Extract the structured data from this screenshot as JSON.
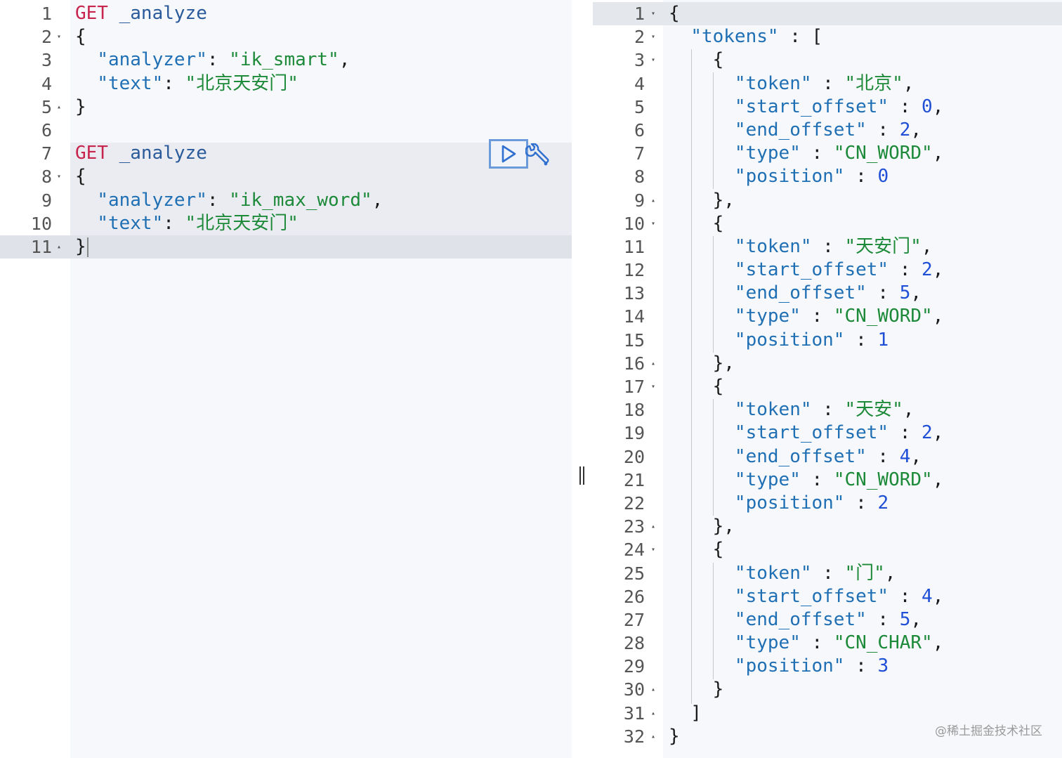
{
  "left_editor": {
    "lines": [
      {
        "n": "1",
        "fold": "",
        "parts": [
          [
            "method",
            "GET"
          ],
          [
            "punc",
            " "
          ],
          [
            "path",
            "_analyze"
          ]
        ]
      },
      {
        "n": "2",
        "fold": "▾",
        "parts": [
          [
            "punc",
            "{"
          ]
        ]
      },
      {
        "n": "3",
        "fold": "",
        "parts": [
          [
            "punc",
            "  "
          ],
          [
            "key",
            "\"analyzer\""
          ],
          [
            "punc",
            ": "
          ],
          [
            "str",
            "\"ik_smart\""
          ],
          [
            "punc",
            ","
          ]
        ]
      },
      {
        "n": "4",
        "fold": "",
        "parts": [
          [
            "punc",
            "  "
          ],
          [
            "key",
            "\"text\""
          ],
          [
            "punc",
            ": "
          ],
          [
            "str",
            "\"北京天安门\""
          ]
        ]
      },
      {
        "n": "5",
        "fold": "▴",
        "parts": [
          [
            "punc",
            "}"
          ]
        ]
      },
      {
        "n": "6",
        "fold": "",
        "parts": []
      },
      {
        "n": "7",
        "fold": "",
        "parts": [
          [
            "method",
            "GET"
          ],
          [
            "punc",
            " "
          ],
          [
            "path",
            "_analyze"
          ]
        ]
      },
      {
        "n": "8",
        "fold": "▾",
        "parts": [
          [
            "punc",
            "{"
          ]
        ]
      },
      {
        "n": "9",
        "fold": "",
        "parts": [
          [
            "punc",
            "  "
          ],
          [
            "key",
            "\"analyzer\""
          ],
          [
            "punc",
            ": "
          ],
          [
            "str",
            "\"ik_max_word\""
          ],
          [
            "punc",
            ","
          ]
        ]
      },
      {
        "n": "10",
        "fold": "",
        "parts": [
          [
            "punc",
            "  "
          ],
          [
            "key",
            "\"text\""
          ],
          [
            "punc",
            ": "
          ],
          [
            "str",
            "\"北京天安门\""
          ]
        ]
      },
      {
        "n": "11",
        "fold": "▴",
        "parts": [
          [
            "punc",
            "}"
          ]
        ]
      }
    ]
  },
  "right_editor": {
    "lines": [
      {
        "n": "1",
        "fold": "▾",
        "parts": [
          [
            "punc",
            "{"
          ]
        ]
      },
      {
        "n": "2",
        "fold": "▾",
        "parts": [
          [
            "punc",
            "  "
          ],
          [
            "key",
            "\"tokens\""
          ],
          [
            "punc",
            " : ["
          ]
        ]
      },
      {
        "n": "3",
        "fold": "▾",
        "parts": [
          [
            "punc",
            "    {"
          ]
        ]
      },
      {
        "n": "4",
        "fold": "",
        "parts": [
          [
            "punc",
            "      "
          ],
          [
            "key",
            "\"token\""
          ],
          [
            "punc",
            " : "
          ],
          [
            "str",
            "\"北京\""
          ],
          [
            "punc",
            ","
          ]
        ]
      },
      {
        "n": "5",
        "fold": "",
        "parts": [
          [
            "punc",
            "      "
          ],
          [
            "key",
            "\"start_offset\""
          ],
          [
            "punc",
            " : "
          ],
          [
            "num",
            "0"
          ],
          [
            "punc",
            ","
          ]
        ]
      },
      {
        "n": "6",
        "fold": "",
        "parts": [
          [
            "punc",
            "      "
          ],
          [
            "key",
            "\"end_offset\""
          ],
          [
            "punc",
            " : "
          ],
          [
            "num",
            "2"
          ],
          [
            "punc",
            ","
          ]
        ]
      },
      {
        "n": "7",
        "fold": "",
        "parts": [
          [
            "punc",
            "      "
          ],
          [
            "key",
            "\"type\""
          ],
          [
            "punc",
            " : "
          ],
          [
            "str",
            "\"CN_WORD\""
          ],
          [
            "punc",
            ","
          ]
        ]
      },
      {
        "n": "8",
        "fold": "",
        "parts": [
          [
            "punc",
            "      "
          ],
          [
            "key",
            "\"position\""
          ],
          [
            "punc",
            " : "
          ],
          [
            "num",
            "0"
          ]
        ]
      },
      {
        "n": "9",
        "fold": "▴",
        "parts": [
          [
            "punc",
            "    },"
          ]
        ]
      },
      {
        "n": "10",
        "fold": "▾",
        "parts": [
          [
            "punc",
            "    {"
          ]
        ]
      },
      {
        "n": "11",
        "fold": "",
        "parts": [
          [
            "punc",
            "      "
          ],
          [
            "key",
            "\"token\""
          ],
          [
            "punc",
            " : "
          ],
          [
            "str",
            "\"天安门\""
          ],
          [
            "punc",
            ","
          ]
        ]
      },
      {
        "n": "12",
        "fold": "",
        "parts": [
          [
            "punc",
            "      "
          ],
          [
            "key",
            "\"start_offset\""
          ],
          [
            "punc",
            " : "
          ],
          [
            "num",
            "2"
          ],
          [
            "punc",
            ","
          ]
        ]
      },
      {
        "n": "13",
        "fold": "",
        "parts": [
          [
            "punc",
            "      "
          ],
          [
            "key",
            "\"end_offset\""
          ],
          [
            "punc",
            " : "
          ],
          [
            "num",
            "5"
          ],
          [
            "punc",
            ","
          ]
        ]
      },
      {
        "n": "14",
        "fold": "",
        "parts": [
          [
            "punc",
            "      "
          ],
          [
            "key",
            "\"type\""
          ],
          [
            "punc",
            " : "
          ],
          [
            "str",
            "\"CN_WORD\""
          ],
          [
            "punc",
            ","
          ]
        ]
      },
      {
        "n": "15",
        "fold": "",
        "parts": [
          [
            "punc",
            "      "
          ],
          [
            "key",
            "\"position\""
          ],
          [
            "punc",
            " : "
          ],
          [
            "num",
            "1"
          ]
        ]
      },
      {
        "n": "16",
        "fold": "▴",
        "parts": [
          [
            "punc",
            "    },"
          ]
        ]
      },
      {
        "n": "17",
        "fold": "▾",
        "parts": [
          [
            "punc",
            "    {"
          ]
        ]
      },
      {
        "n": "18",
        "fold": "",
        "parts": [
          [
            "punc",
            "      "
          ],
          [
            "key",
            "\"token\""
          ],
          [
            "punc",
            " : "
          ],
          [
            "str",
            "\"天安\""
          ],
          [
            "punc",
            ","
          ]
        ]
      },
      {
        "n": "19",
        "fold": "",
        "parts": [
          [
            "punc",
            "      "
          ],
          [
            "key",
            "\"start_offset\""
          ],
          [
            "punc",
            " : "
          ],
          [
            "num",
            "2"
          ],
          [
            "punc",
            ","
          ]
        ]
      },
      {
        "n": "20",
        "fold": "",
        "parts": [
          [
            "punc",
            "      "
          ],
          [
            "key",
            "\"end_offset\""
          ],
          [
            "punc",
            " : "
          ],
          [
            "num",
            "4"
          ],
          [
            "punc",
            ","
          ]
        ]
      },
      {
        "n": "21",
        "fold": "",
        "parts": [
          [
            "punc",
            "      "
          ],
          [
            "key",
            "\"type\""
          ],
          [
            "punc",
            " : "
          ],
          [
            "str",
            "\"CN_WORD\""
          ],
          [
            "punc",
            ","
          ]
        ]
      },
      {
        "n": "22",
        "fold": "",
        "parts": [
          [
            "punc",
            "      "
          ],
          [
            "key",
            "\"position\""
          ],
          [
            "punc",
            " : "
          ],
          [
            "num",
            "2"
          ]
        ]
      },
      {
        "n": "23",
        "fold": "▴",
        "parts": [
          [
            "punc",
            "    },"
          ]
        ]
      },
      {
        "n": "24",
        "fold": "▾",
        "parts": [
          [
            "punc",
            "    {"
          ]
        ]
      },
      {
        "n": "25",
        "fold": "",
        "parts": [
          [
            "punc",
            "      "
          ],
          [
            "key",
            "\"token\""
          ],
          [
            "punc",
            " : "
          ],
          [
            "str",
            "\"门\""
          ],
          [
            "punc",
            ","
          ]
        ]
      },
      {
        "n": "26",
        "fold": "",
        "parts": [
          [
            "punc",
            "      "
          ],
          [
            "key",
            "\"start_offset\""
          ],
          [
            "punc",
            " : "
          ],
          [
            "num",
            "4"
          ],
          [
            "punc",
            ","
          ]
        ]
      },
      {
        "n": "27",
        "fold": "",
        "parts": [
          [
            "punc",
            "      "
          ],
          [
            "key",
            "\"end_offset\""
          ],
          [
            "punc",
            " : "
          ],
          [
            "num",
            "5"
          ],
          [
            "punc",
            ","
          ]
        ]
      },
      {
        "n": "28",
        "fold": "",
        "parts": [
          [
            "punc",
            "      "
          ],
          [
            "key",
            "\"type\""
          ],
          [
            "punc",
            " : "
          ],
          [
            "str",
            "\"CN_CHAR\""
          ],
          [
            "punc",
            ","
          ]
        ]
      },
      {
        "n": "29",
        "fold": "",
        "parts": [
          [
            "punc",
            "      "
          ],
          [
            "key",
            "\"position\""
          ],
          [
            "punc",
            " : "
          ],
          [
            "num",
            "3"
          ]
        ]
      },
      {
        "n": "30",
        "fold": "▴",
        "parts": [
          [
            "punc",
            "    }"
          ]
        ]
      },
      {
        "n": "31",
        "fold": "▴",
        "parts": [
          [
            "punc",
            "  ]"
          ]
        ]
      },
      {
        "n": "32",
        "fold": "▴",
        "parts": [
          [
            "punc",
            "}"
          ]
        ]
      }
    ]
  },
  "icons": {
    "run": "play-icon",
    "settings": "wrench-icon",
    "resize": "resize-handle-icon"
  },
  "colors": {
    "method": "#c7254e",
    "key": "#1f6fb4",
    "string": "#1d8a3a",
    "number": "#1f4fd6",
    "run_button_border": "#6b9bd8"
  },
  "watermark": "@稀土掘金技术社区"
}
